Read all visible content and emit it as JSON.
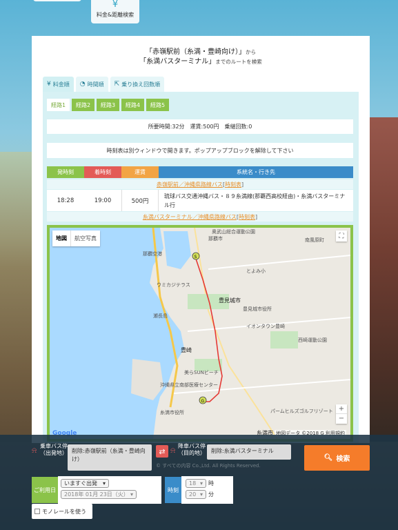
{
  "top_tab": {
    "icon": "yen-icon",
    "label": "料金&距離検索"
  },
  "route_heading": {
    "from": "「赤嶺駅前（糸満・豊崎向け）」",
    "from_suffix": "から",
    "to": "「糸満バスターミナル」",
    "to_suffix": "までのルートを検索"
  },
  "sort_tabs": [
    {
      "icon": "yen-icon",
      "label": "料金順"
    },
    {
      "icon": "clock-icon",
      "label": "時間順"
    },
    {
      "icon": "transfer-icon",
      "label": "乗り換え回数順"
    }
  ],
  "routes": [
    "経路1",
    "経路2",
    "経路3",
    "経路4",
    "経路5"
  ],
  "summary": "所要時間:32分　運賃:500円　乗継回数:0",
  "notice": "時刻表は別ウィンドウで開きます。ポップアップブロックを解除して下さい",
  "table": {
    "headers": [
      "発時刻",
      "着時刻",
      "運賃",
      "系統名・行き先"
    ],
    "departure_stop": {
      "name": "赤嶺駅前／沖縄県路線バス",
      "timetable": "時刻表"
    },
    "row": {
      "dep": "18:28",
      "arr": "19:00",
      "fare": "500円",
      "line": "琉球バス交通沖縄バス・８９糸満線(那覇西高校経由)・糸満バスターミナル行"
    },
    "arrival_stop": {
      "name": "糸満バスターミナル／沖縄県路線バス",
      "timetable": "時刻表"
    }
  },
  "map": {
    "type_map": "地図",
    "type_satellite": "航空写真",
    "google": "Google",
    "copyright": "地図データ ©2018 G 利用規約",
    "labels": [
      "奥武山総合運動公園",
      "那覇空港",
      "那覇市",
      "瀬長島",
      "豊見城市",
      "豊崎",
      "糸満市",
      "イオンタウン豊崎",
      "糸満市役所",
      "沖縄県立南部医療センター",
      "豊見城市役所",
      "ウミカジテラス",
      "とよみ小",
      "美らSUNビーチ",
      "西崎運動公園",
      "パームヒルズゴルフリゾート",
      "南風原町"
    ]
  },
  "search": {
    "board_label": "乗車バス停（出発地）",
    "board_value": "削除:赤嶺駅前（糸満・豊崎向け）",
    "alight_label": "降車バス停（目的地）",
    "alight_value": "削除:糸満バスターミナル",
    "search_button": "検索",
    "date_label": "ご利用日",
    "mode_value": "いますぐ出発",
    "date_value": "2018年 01月 23日（火）",
    "time_label": "時刻",
    "hour_value": "18",
    "hour_unit": "時",
    "minute_value": "20",
    "minute_unit": "分",
    "monorail": "モノレールを使う",
    "watermark": "© すべての内容 Co.,Ltd. All Rights Reserved."
  }
}
